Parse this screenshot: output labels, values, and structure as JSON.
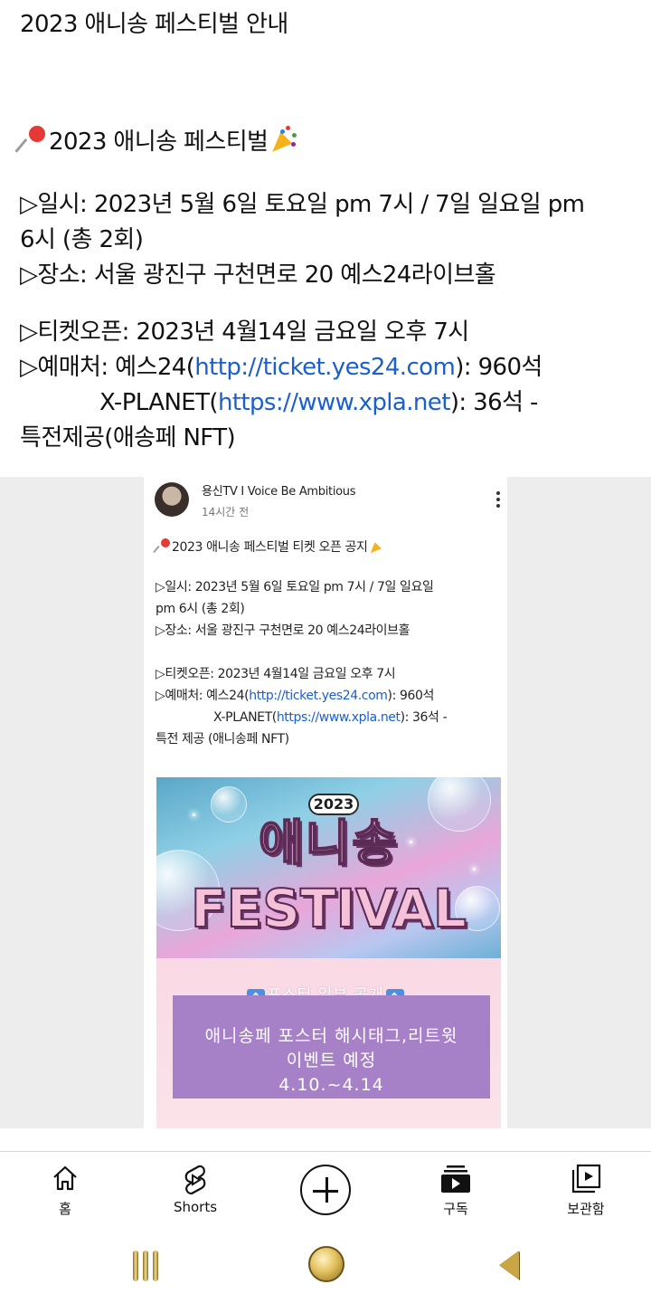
{
  "post": {
    "title": "2023 애니송 페스티벌 안내",
    "heading": "2023 애니송 페스티벌",
    "date_line_1": "▷일시: 2023년 5월 6일 토요일 pm 7시 / 7일 일요일 pm",
    "date_line_2": "6시 (총 2회)",
    "venue": "▷장소: 서울 광진구 구천면로 20 예스24라이브홀",
    "ticket_open": "▷티켓오픈: 2023년 4월14일 금요일 오후 7시",
    "sales_prefix": "▷예매처: 예스24(",
    "sales_link_1": "http://ticket.yes24.com",
    "sales_suffix_1": "): 960석",
    "sales2_prefix": "X-PLANET(",
    "sales_link_2": "https://www.xpla.net",
    "sales_suffix_2": "): 36석 -",
    "benefit": "특전제공(애송페 NFT)"
  },
  "embed": {
    "channel": "용신TV I Voice Be Ambitious",
    "time": "14시간 전",
    "heading": "2023 애니송 페스티벌 티켓 오픈 공지",
    "date_line_1": "▷일시: 2023년 5월 6일 토요일 pm 7시 / 7일 일요일",
    "date_line_2": "pm 6시 (총 2회)",
    "venue": "▷장소: 서울 광진구 구천면로 20 예스24라이브홀",
    "ticket_open": "▷티켓오픈: 2023년 4월14일 금요일 오후 7시",
    "sales_prefix": "▷예매처: 예스24(",
    "sales_link_1": "http://ticket.yes24.com",
    "sales_suffix_1": "): 960석",
    "sales2_prefix": "X-PLANET(",
    "sales_link_2": "https://www.xpla.net",
    "sales_suffix_2": "): 36석 -",
    "benefit": "특전 제공 (애니송페 NFT)",
    "poster": {
      "year": "2023",
      "title_ko": "애니송",
      "title_en": "FESTIVAL"
    },
    "notice": {
      "head": "포스터 일부 공개",
      "line_1": "애니송페 포스터 해시태그,리트윗",
      "line_2": "이벤트 예정",
      "line_3": "4.10.~4.14"
    }
  },
  "bottom_nav": {
    "home": "홈",
    "shorts": "Shorts",
    "subscriptions": "구독",
    "library": "보관함"
  },
  "colors": {
    "link": "#1a5fd0",
    "notice_box": "#a781c8",
    "gray_band": "#ededed"
  }
}
